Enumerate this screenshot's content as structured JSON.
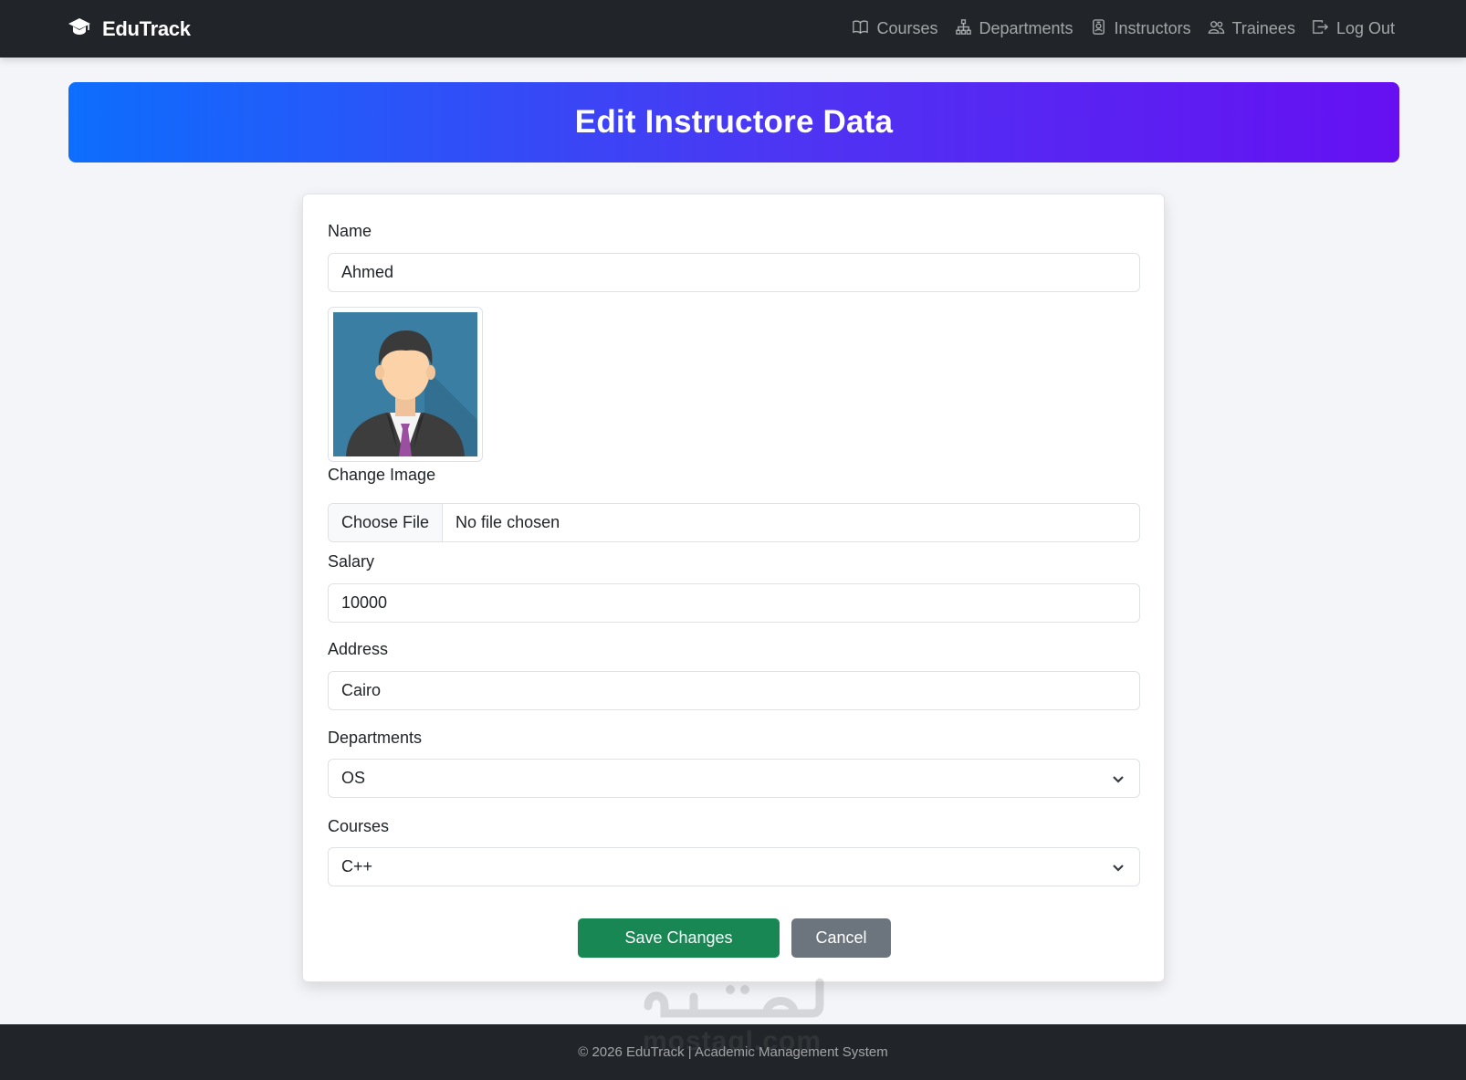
{
  "navbar": {
    "brand": "EduTrack",
    "links": [
      {
        "label": "Courses",
        "icon": "book-icon"
      },
      {
        "label": "Departments",
        "icon": "sitemap-icon"
      },
      {
        "label": "Instructors",
        "icon": "person-badge-icon"
      },
      {
        "label": "Trainees",
        "icon": "people-icon"
      },
      {
        "label": "Log Out",
        "icon": "logout-icon"
      }
    ]
  },
  "page": {
    "title": "Edit Instructore Data"
  },
  "form": {
    "name_label": "Name",
    "name_value": "Ahmed",
    "photo_alt": "Instructor photo",
    "image_label": "Change Image",
    "file_button": "Choose File",
    "file_status": "No file chosen",
    "salary_label": "Salary",
    "salary_value": "10000",
    "address_label": "Address",
    "address_value": "Cairo",
    "departments_label": "Departments",
    "department_selected": "OS",
    "courses_label": "Courses",
    "course_selected": "C++",
    "save_label": "Save Changes",
    "cancel_label": "Cancel"
  },
  "footer": {
    "text": "© 2026 EduTrack | Academic Management System"
  },
  "watermark": {
    "text": "mostaql.com"
  },
  "colors": {
    "navbar_bg": "#212529",
    "banner_start": "#0d6efd",
    "banner_end": "#6610f2",
    "save_button": "#198754",
    "cancel_button": "#6c757d",
    "page_bg": "#f3f5f9"
  }
}
